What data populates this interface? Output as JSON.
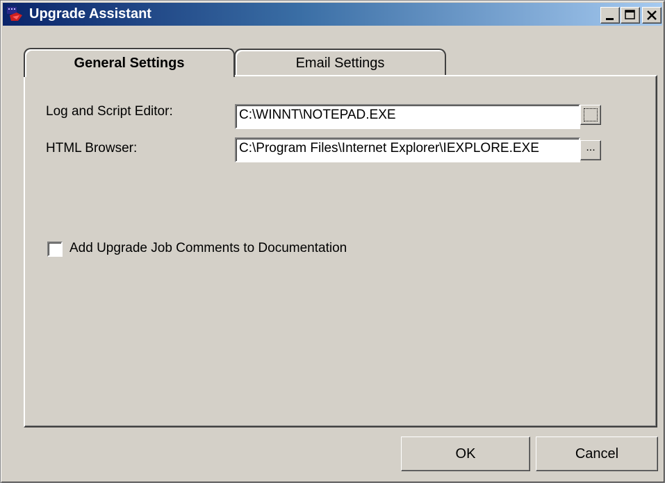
{
  "window": {
    "title": "Upgrade Assistant",
    "icon": "app-icon",
    "controls": [
      "minimize-icon",
      "maximize-icon",
      "close-icon"
    ]
  },
  "tabs": [
    {
      "label": "General Settings",
      "selected": true
    },
    {
      "label": "Email Settings",
      "selected": false
    }
  ],
  "general": {
    "editor_label": "Log and Script Editor:",
    "editor_value": "C:\\WINNT\\NOTEPAD.EXE",
    "browser_label": "HTML Browser:",
    "browser_value": "C:\\Program Files\\Internet Explorer\\IEXPLORE.EXE",
    "browse_label": "...",
    "comments_checkbox_label": "Add Upgrade Job Comments to Documentation",
    "comments_checked": false
  },
  "buttons": {
    "ok": "OK",
    "cancel": "Cancel"
  },
  "colors": {
    "title_start": "#0a246a",
    "title_end": "#a6caf0",
    "face": "#d4d0c8"
  }
}
